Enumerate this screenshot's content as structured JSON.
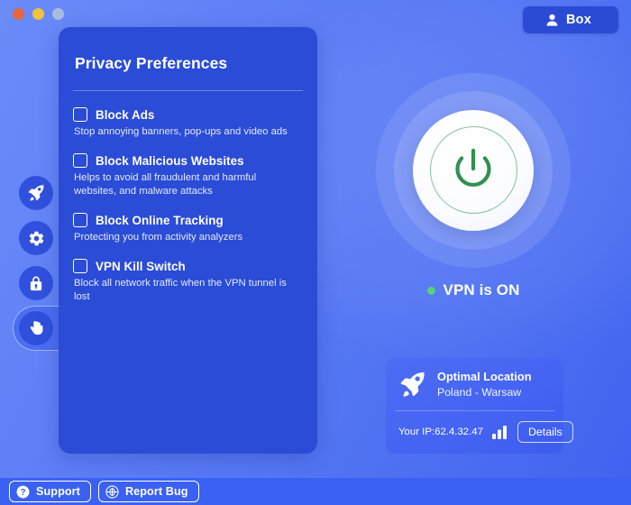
{
  "window": {
    "traffic_lights": [
      {
        "name": "close",
        "color": "#e8663c"
      },
      {
        "name": "minimize",
        "color": "#f3c13c"
      },
      {
        "name": "maximize",
        "color": "#a8bce0"
      }
    ]
  },
  "account_button": {
    "label": "Box",
    "icon": "person-icon",
    "background": "#2b4bd4"
  },
  "sidebar": {
    "items": [
      {
        "name": "sidebar-item-speed",
        "icon": "rocket-icon",
        "active": false
      },
      {
        "name": "sidebar-item-settings",
        "icon": "gear-icon",
        "active": false
      },
      {
        "name": "sidebar-item-security",
        "icon": "lock-icon",
        "active": false
      },
      {
        "name": "sidebar-item-privacy",
        "icon": "hand-icon",
        "active": true
      }
    ]
  },
  "panel": {
    "title": "Privacy Preferences",
    "background": "#2b4cd6",
    "preferences": [
      {
        "label": "Block Ads",
        "description": "Stop annoying banners, pop-ups and video ads",
        "checked": false
      },
      {
        "label": "Block Malicious Websites",
        "description": "Helps to avoid all fraudulent and harmful websites, and malware attacks",
        "checked": false
      },
      {
        "label": "Block Online Tracking",
        "description": "Protecting you from activity analyzers",
        "checked": false
      },
      {
        "label": "VPN Kill Switch",
        "description": "Block all network traffic when the VPN tunnel is lost",
        "checked": false
      }
    ]
  },
  "power": {
    "icon": "power-icon",
    "accent": "#2e9150",
    "state": "on"
  },
  "status": {
    "text": "VPN is ON",
    "dot_color": "#58d17a"
  },
  "location_card": {
    "icon": "rocket-icon",
    "title": "Optimal Location",
    "subtitle": "Poland - Warsaw",
    "ip_label": "Your IP:62.4.32.47",
    "signal_icon": "signal-bars-icon",
    "details_label": "Details"
  },
  "bottom_bar": {
    "background": "#3a61f2",
    "buttons": [
      {
        "label": "Support",
        "icon": "question-circle-icon"
      },
      {
        "label": "Report Bug",
        "icon": "bug-target-icon"
      }
    ]
  }
}
